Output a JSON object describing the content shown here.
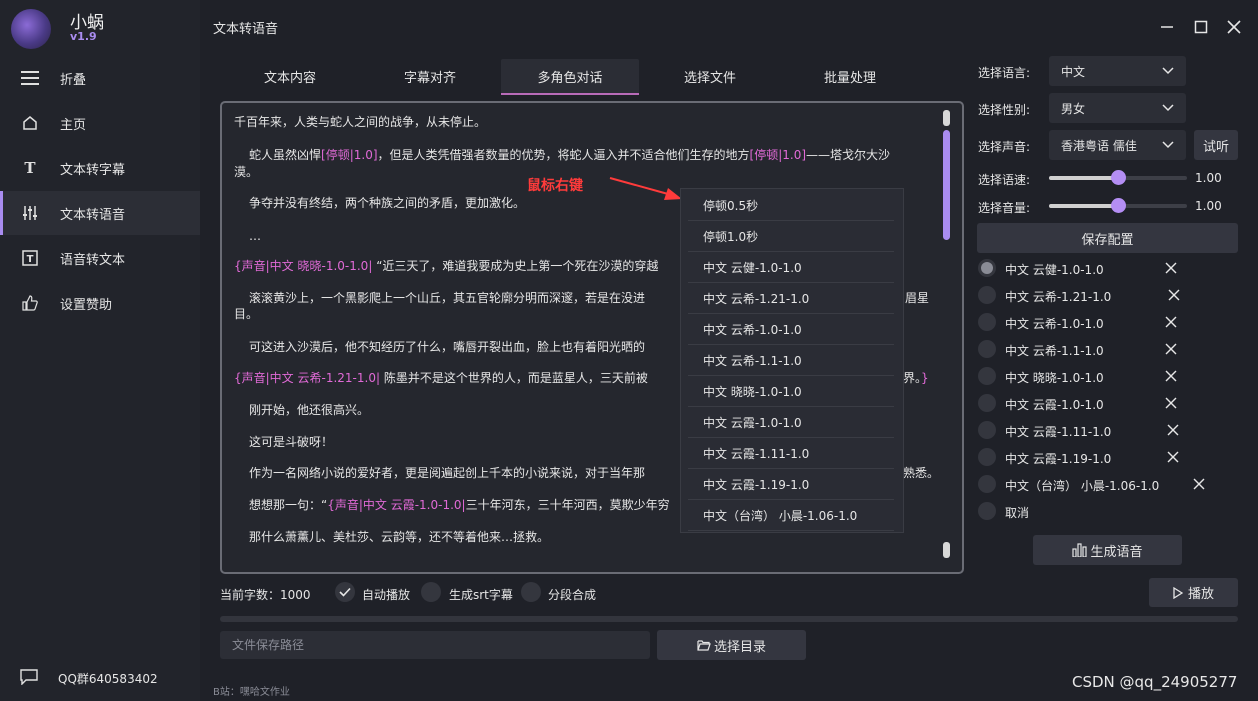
{
  "app": {
    "name": "小蜗",
    "version": "v1.9",
    "window_title": "文本转语音"
  },
  "sidebar": {
    "collapse_label": "折叠",
    "items": [
      {
        "label": "主页",
        "icon": "home-icon"
      },
      {
        "label": "文本转字幕",
        "icon": "text-t-icon"
      },
      {
        "label": "文本转语音",
        "icon": "sliders-icon",
        "active": true
      },
      {
        "label": "语音转文本",
        "icon": "text-box-icon"
      },
      {
        "label": "设置赞助",
        "icon": "thumbs-up-icon"
      }
    ],
    "footer": "QQ群640583402"
  },
  "tabs": [
    "文本内容",
    "字幕对齐",
    "多角色对话",
    "选择文件",
    "批量处理"
  ],
  "active_tab": "多角色对话",
  "editor": {
    "p1": "千百年来，人类与蛇人之间的战争，从未停止。",
    "p2a": "蛇人虽然凶悍",
    "p2b": "[停顿|1.0]",
    "p2c": "，但是人类凭借强者数量的优势，将蛇人逼入并不适合他们生存的地方",
    "p2d": "[停顿|1.0]",
    "p2e": "——塔戈尔大沙",
    "p2f": "漠。",
    "p3": "争夺并没有终结，两个种族之间的矛盾，更加激化。",
    "p4": "…",
    "p5a": "{声音|中文 晓晓-1.0-1.0|",
    "p5b": "   “近三天了，难道我要成为史上第一个死在沙漠的穿越",
    "p6a": "滚滚黄沙上，一个黑影爬上一个山丘，其五官轮廓分明而深邃，若是在没进",
    "p6b": "眉星",
    "p6c": "目。",
    "p7": "可这进入沙漠后，他不知经历了什么，嘴唇开裂出血，脸上也有着阳光晒的",
    "p8a": "{声音|中文 云希-1.21-1.0|",
    "p8b": "   陈墨并不是这个世界的人，而是蓝星人，三天前被",
    "p8c": "界。",
    "p8d": "}",
    "p9": "刚开始，他还很高兴。",
    "p10": "这可是斗破呀！",
    "p11a": "作为一名网络小说的爱好者，更是阅遍起创上千本的小说来说，对于当年那",
    "p11b": "熟悉。",
    "p12a": "想想那一句：“",
    "p12b": "{声音|中文 云霞-1.0-1.0|",
    "p12c": "三十年河东，三十年河西，莫欺少年穷",
    "p13": "那什么萧薰儿、美杜莎、云韵等，还不等着他来…拯救。"
  },
  "annotation": "鼠标右键",
  "context_menu": [
    "停顿0.5秒",
    "停顿1.0秒",
    "中文 云健-1.0-1.0",
    "中文 云希-1.21-1.0",
    "中文 云希-1.0-1.0",
    "中文 云希-1.1-1.0",
    "中文 晓晓-1.0-1.0",
    "中文 云霞-1.0-1.0",
    "中文 云霞-1.11-1.0",
    "中文 云霞-1.19-1.0",
    "中文（台湾） 小晨-1.06-1.0"
  ],
  "settings": {
    "language_label": "选择语言:",
    "language_value": "中文",
    "gender_label": "选择性别:",
    "gender_value": "男女",
    "voice_label": "选择声音:",
    "voice_value": "香港粤语 儒佳",
    "audition_label": "试听",
    "rate_label": "选择语速:",
    "rate_value": "1.00",
    "rate_fraction": 0.5,
    "volume_label": "选择音量:",
    "volume_value": "1.00",
    "volume_fraction": 0.5,
    "save_label": "保存配置"
  },
  "voice_list": [
    "中文 云健-1.0-1.0",
    "中文 云希-1.21-1.0",
    "中文 云希-1.0-1.0",
    "中文 云希-1.1-1.0",
    "中文 晓晓-1.0-1.0",
    "中文 云霞-1.0-1.0",
    "中文 云霞-1.11-1.0",
    "中文 云霞-1.19-1.0",
    "中文（台湾） 小晨-1.06-1.0",
    "取消"
  ],
  "generate_label": "生成语音",
  "bottom": {
    "char_count": "当前字数：1000",
    "autoplay": "自动播放",
    "srt": "生成srt字幕",
    "segment": "分段合成",
    "play": "播放",
    "path_placeholder": "文件保存路径",
    "choose_dir": "选择目录",
    "status": "B站：嘿哈文作业"
  },
  "watermark": "CSDN @qq_24905277"
}
